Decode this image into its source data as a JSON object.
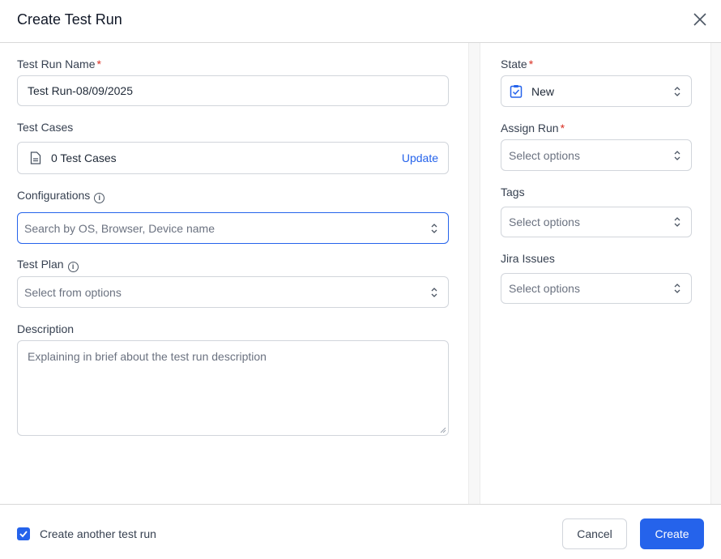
{
  "dialog": {
    "title": "Create Test Run"
  },
  "left": {
    "name_label": "Test Run Name",
    "name_value": "Test Run-08/09/2025",
    "cases_label": "Test Cases",
    "cases_value": "0 Test Cases",
    "cases_update": "Update",
    "config_label": "Configurations",
    "config_placeholder": "Search by OS, Browser, Device name",
    "plan_label": "Test Plan",
    "plan_placeholder": "Select from options",
    "desc_label": "Description",
    "desc_placeholder": "Explaining in brief about the test run description"
  },
  "right": {
    "state_label": "State",
    "state_value": "New",
    "assign_label": "Assign Run",
    "assign_placeholder": "Select options",
    "tags_label": "Tags",
    "tags_placeholder": "Select options",
    "jira_label": "Jira Issues",
    "jira_placeholder": "Select options"
  },
  "footer": {
    "another_label": "Create another test run",
    "another_checked": true,
    "cancel": "Cancel",
    "create": "Create"
  },
  "colors": {
    "accent": "#2563eb",
    "required": "#d92d20"
  }
}
